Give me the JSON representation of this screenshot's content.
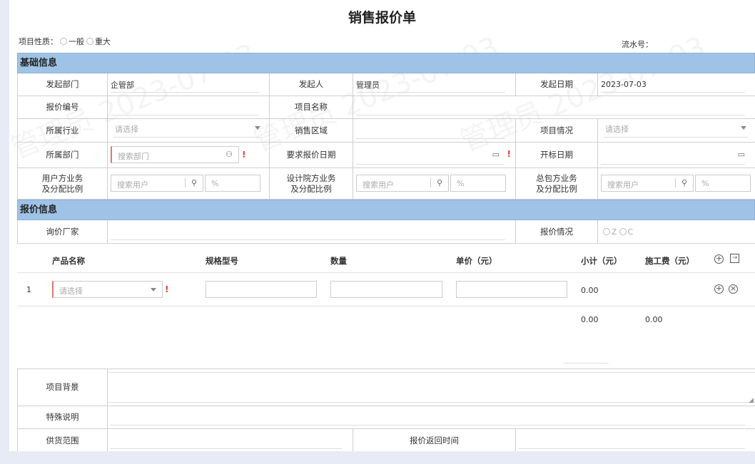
{
  "title": "销售报价单",
  "project_nature": {
    "label": "项目性质：",
    "options": [
      "一般",
      "重大"
    ]
  },
  "serial_label": "流水号：",
  "sections": {
    "basic": "基础信息",
    "quote": "报价信息"
  },
  "basic": {
    "dept_label": "发起部门",
    "dept_value": "企管部",
    "initiator_label": "发起人",
    "initiator_value": "管理员",
    "date_label": "发起日期",
    "date_value": "2023-07-03",
    "quote_no_label": "报价编号",
    "project_name_label": "项目名称",
    "industry_label": "所属行业",
    "industry_placeholder": "请选择",
    "region_label": "销售区域",
    "project_status_label": "项目情况",
    "project_status_placeholder": "请选择",
    "owner_dept_label": "所属部门",
    "owner_dept_placeholder": "搜索部门",
    "required_date_label": "要求报价日期",
    "bid_date_label": "开标日期",
    "user_biz_label_1": "用户方业务",
    "user_biz_label_2": "及分配比例",
    "design_biz_label_1": "设计院方业务",
    "design_biz_label_2": "及分配比例",
    "general_biz_label_1": "总包方业务",
    "general_biz_label_2": "及分配比例",
    "search_user_placeholder": "搜索用户",
    "percent": "%"
  },
  "quote": {
    "vendor_label": "询价厂家",
    "quote_status_label": "报价情况",
    "quote_status_options": [
      "Z",
      "C"
    ]
  },
  "product_table": {
    "headers": [
      "产品名称",
      "规格型号",
      "数量",
      "单价（元）",
      "小计（元）",
      "施工费（元）"
    ],
    "rows": [
      {
        "index": "1",
        "product_placeholder": "请选择",
        "subtotal": "0.00"
      }
    ],
    "total_subtotal": "0.00",
    "total_install": "0.00"
  },
  "bottom": {
    "background_label": "项目背景",
    "special_label": "特殊说明",
    "supply_label": "供货范围",
    "return_time_label": "报价返回时间"
  },
  "watermark": "管理员 2023-07-03"
}
